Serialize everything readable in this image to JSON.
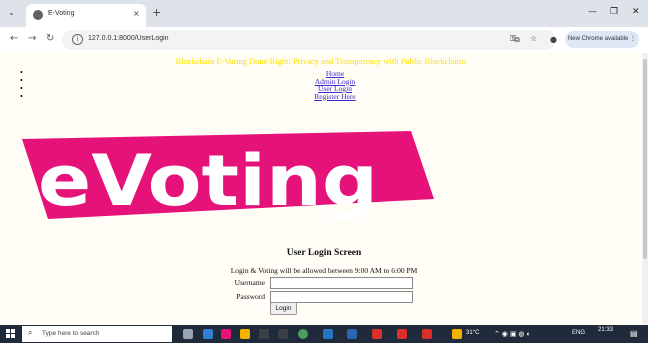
{
  "browser": {
    "tab_title": "E-Voting",
    "url": "127.0.0.1:8000/UserLogin",
    "update_label": "New Chrome available",
    "tab_close": "×",
    "new_tab": "+"
  },
  "page": {
    "banner": "Blockchain E-Voting Done Right: Privacy and Transparency with Public Blockchains",
    "menu": [
      "Home",
      "Admin Login",
      "User Login",
      "Register Here"
    ],
    "logo_text": "eVoting",
    "login_title": "User Login Screen",
    "notice": "Login & Voting will be allowed between 9:00 AM to 6:00 PM",
    "username_label": "Username",
    "password_label": "Password",
    "login_button": "Login"
  },
  "taskbar": {
    "search_placeholder": "Type here to search",
    "temperature": "31°C",
    "language": "ENG",
    "time": "21:33"
  },
  "colors": {
    "banner": "#ffe000",
    "logo_pink": "#e5127a",
    "page_bg": "#fffdf5",
    "link": "#3b2bd0"
  }
}
